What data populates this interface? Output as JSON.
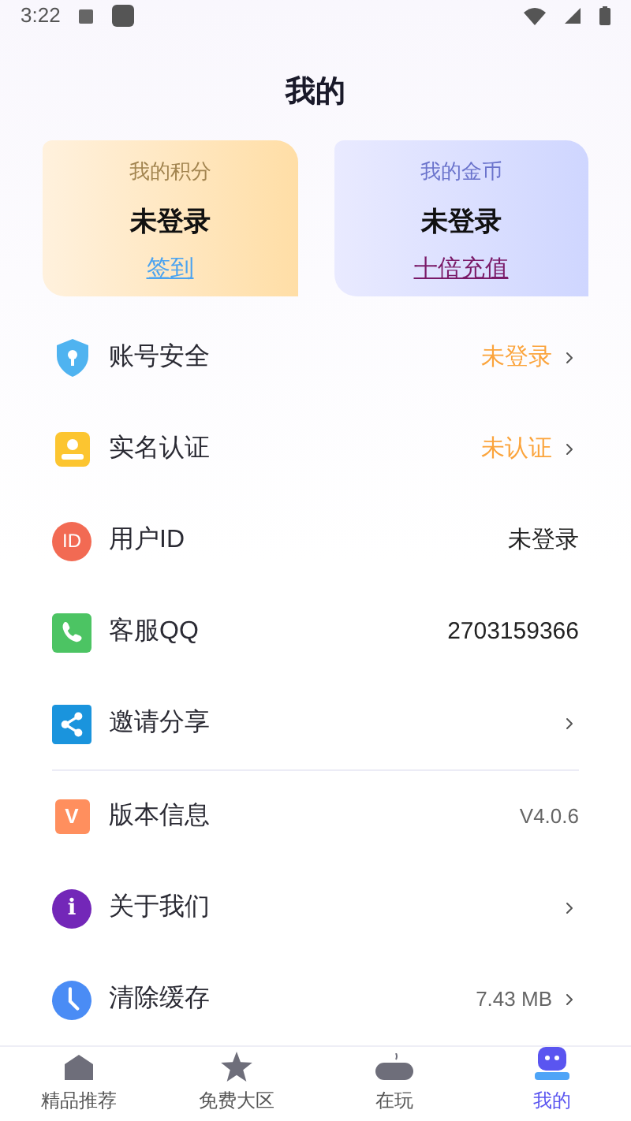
{
  "status_bar": {
    "time": "3:22"
  },
  "title": "我的",
  "cards": [
    {
      "kind": "points",
      "label": "我的积分",
      "value": "未登录",
      "link": "签到"
    },
    {
      "kind": "coins",
      "label": "我的金币",
      "value": "未登录",
      "link": "十倍充值"
    }
  ],
  "menu_groups": [
    [
      {
        "kind": "shield",
        "label": "账号安全",
        "value": "未登录",
        "highlight": true,
        "chevron": true
      },
      {
        "kind": "person",
        "label": "实名认证",
        "value": "未认证",
        "highlight": true,
        "chevron": true
      },
      {
        "kind": "id",
        "badge": "ID",
        "label": "用户ID",
        "value": "未登录",
        "highlight": false,
        "chevron": false
      },
      {
        "kind": "phone",
        "label": "客服QQ",
        "value": "2703159366",
        "highlight": false,
        "chevron": false
      },
      {
        "kind": "share",
        "label": "邀请分享",
        "chevron": true
      }
    ],
    [
      {
        "kind": "version",
        "badge": "V",
        "label": "版本信息",
        "value": "V4.0.6",
        "highlight": false,
        "chevron": false,
        "muted": true
      },
      {
        "kind": "info",
        "badge": "i",
        "label": "关于我们",
        "chevron": true
      },
      {
        "kind": "clock",
        "label": "清除缓存",
        "value": "7.43 MB",
        "highlight": false,
        "chevron": true,
        "muted": true
      }
    ]
  ],
  "nav": [
    {
      "kind": "home",
      "label": "精品推荐",
      "selected": false
    },
    {
      "kind": "star",
      "label": "免费大区",
      "selected": false
    },
    {
      "kind": "gamepad",
      "label": "在玩",
      "selected": false
    },
    {
      "kind": "bot",
      "label": "我的",
      "selected": true
    }
  ]
}
